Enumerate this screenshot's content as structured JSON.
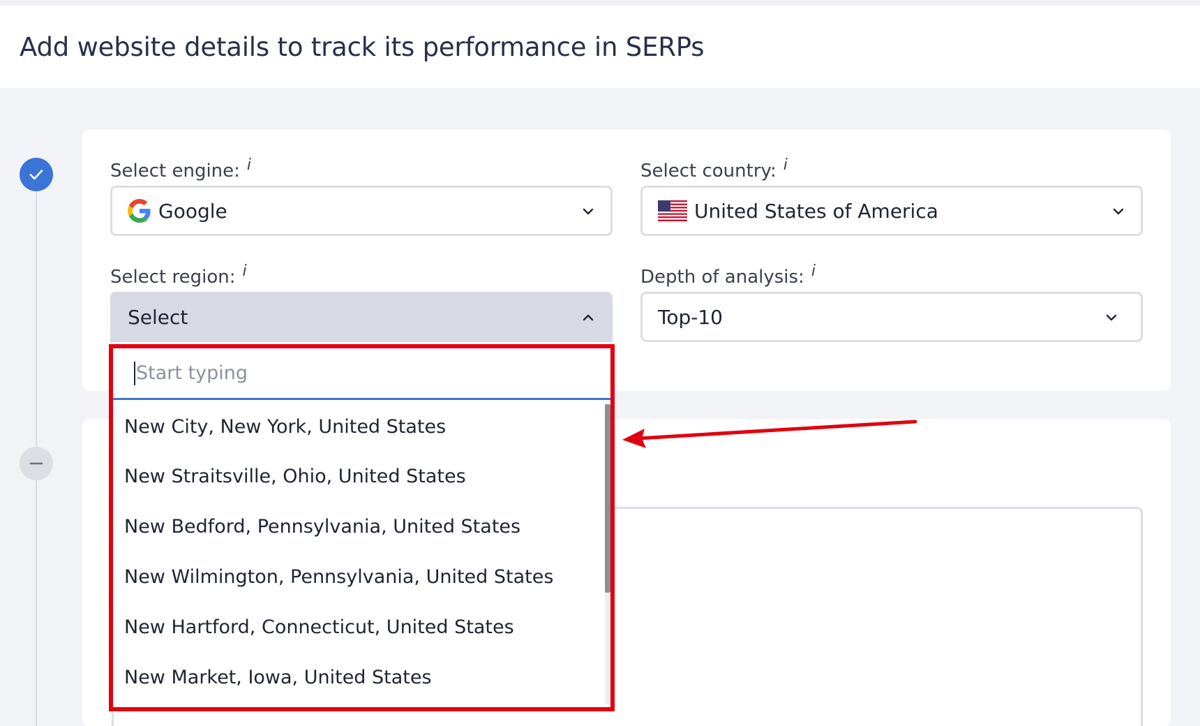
{
  "header": {
    "title": "Add website details to track its performance in SERPs"
  },
  "steps": [
    {
      "state": "done",
      "icon": "check-icon"
    },
    {
      "state": "pending",
      "icon": "minus-icon"
    }
  ],
  "form": {
    "engine": {
      "label": "Select engine:",
      "info": "i",
      "value": "Google",
      "icon": "google-g-icon"
    },
    "country": {
      "label": "Select country:",
      "info": "i",
      "value": "United States of America",
      "icon": "us-flag-icon"
    },
    "region": {
      "label": "Select region:",
      "info": "i",
      "value": "Select",
      "open": true
    },
    "depth": {
      "label": "Depth of analysis:",
      "info": "i",
      "value": "Top-10"
    }
  },
  "region_dropdown": {
    "search_placeholder": "Start typing",
    "options": [
      "New City, New York, United States",
      "New Straitsville, Ohio, United States",
      "New Bedford, Pennsylvania, United States",
      "New Wilmington, Pennsylvania, United States",
      "New Hartford, Connecticut, United States",
      "New Market, Iowa, United States"
    ],
    "scroll_position": 0.0
  },
  "colors": {
    "accent": "#3b73d6",
    "annotation": "#e1000f",
    "background": "#f2f3f7",
    "open_select": "#d8dae3"
  }
}
